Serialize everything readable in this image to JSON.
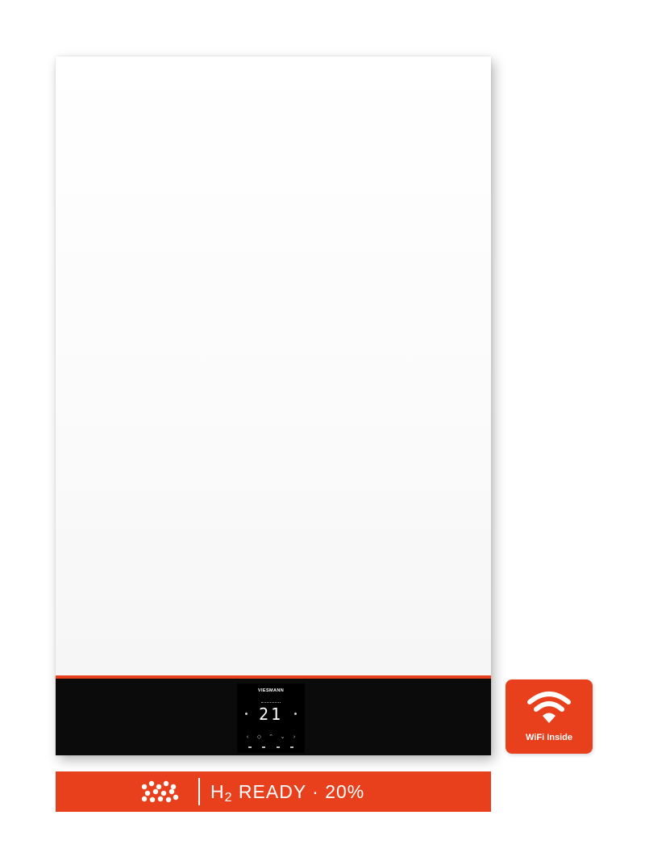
{
  "colors": {
    "accent": "#e8401c",
    "panel": "#ffffff",
    "control_band": "#0b0b0b",
    "display_text": "#ffffff"
  },
  "display": {
    "brand": "VIESMANN",
    "temperature": "21",
    "buttons": [
      "‹",
      "◇",
      "⌃",
      "⌄",
      "›"
    ]
  },
  "banner": {
    "logo_icon": "hydrogen-molecule-icon",
    "h2_main": "H",
    "h2_sub": "2",
    "text": " READY · 20%"
  },
  "wifi_badge": {
    "icon": "wifi-icon",
    "label": "WiFi Inside"
  }
}
